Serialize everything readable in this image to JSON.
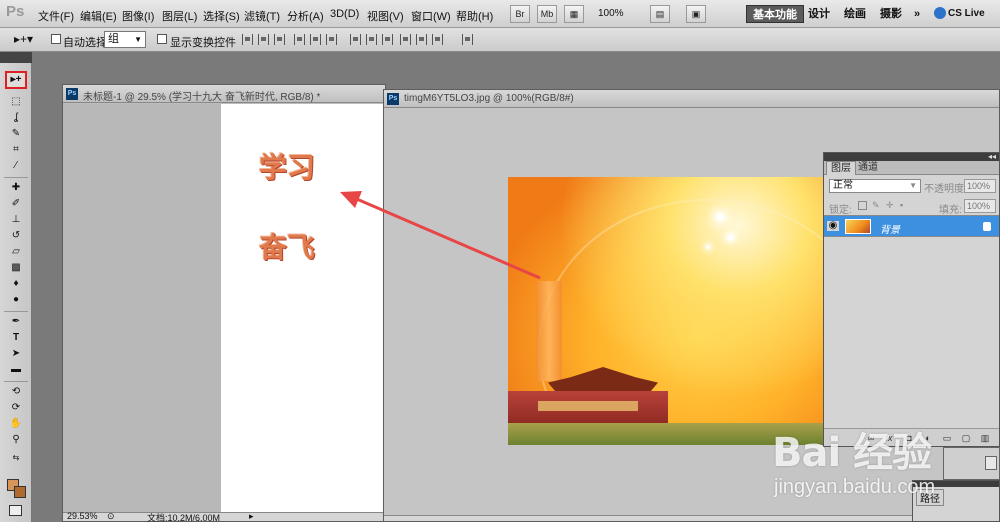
{
  "app": {
    "logo": "Ps"
  },
  "menu": [
    "文件(F)",
    "编辑(E)",
    "图像(I)",
    "图层(L)",
    "选择(S)",
    "滤镜(T)",
    "分析(A)",
    "3D(D)",
    "视图(V)",
    "窗口(W)",
    "帮助(H)"
  ],
  "menubar": {
    "br_label": "Br",
    "mb_label": "Mb",
    "zoom": "100%",
    "workspaces": [
      "基本功能",
      "设计",
      "绘画",
      "摄影"
    ],
    "more": "»",
    "cs_live": "CS Live"
  },
  "options": {
    "auto_select_label": "自动选择:",
    "auto_select_value": "组",
    "show_transform_label": "显示变换控件"
  },
  "toolbox": {
    "tools": [
      "move-tool",
      "marquee-tool",
      "lasso-tool",
      "quick-select-tool",
      "crop-tool",
      "eyedropper-tool",
      "healing-brush-tool",
      "brush-tool",
      "clone-stamp-tool",
      "history-brush-tool",
      "eraser-tool",
      "gradient-tool",
      "blur-tool",
      "dodge-tool",
      "pen-tool",
      "type-tool",
      "path-selection-tool",
      "shape-tool",
      "3d-rotate-tool",
      "3d-orbit-tool",
      "hand-tool",
      "zoom-tool"
    ],
    "colors": {
      "foreground": "#d79659",
      "background": "#b06a2e"
    }
  },
  "doc1": {
    "title": "未标题-1 @ 29.5% (学习十九大   奋飞新时代, RGB/8) *",
    "text_line1": "学习",
    "text_line2": "奋飞",
    "zoom": "29.53%",
    "doc_size": "文档:10.2M/6.00M"
  },
  "doc2": {
    "title": "timgM6YT5LO3.jpg @ 100%(RGB/8#)"
  },
  "layers_panel": {
    "tabs": [
      "图层",
      "通道"
    ],
    "blend_mode": "正常",
    "opacity_label": "不透明度:",
    "opacity_value": "100%",
    "lock_label": "锁定:",
    "fill_label": "填充:",
    "fill_value": "100%",
    "layer_name": "背景",
    "footer_icons": [
      "link-icon",
      "fx-icon",
      "mask-icon",
      "adjustment-icon",
      "group-icon",
      "new-layer-icon",
      "trash-icon"
    ]
  },
  "paths_panel": {
    "tab": "路径"
  },
  "watermark": {
    "brand": "Bai 经验",
    "url": "jingyan.baidu.com"
  },
  "colors": {
    "accent_red": "#e02020",
    "selection_blue": "#3d8fe0"
  }
}
